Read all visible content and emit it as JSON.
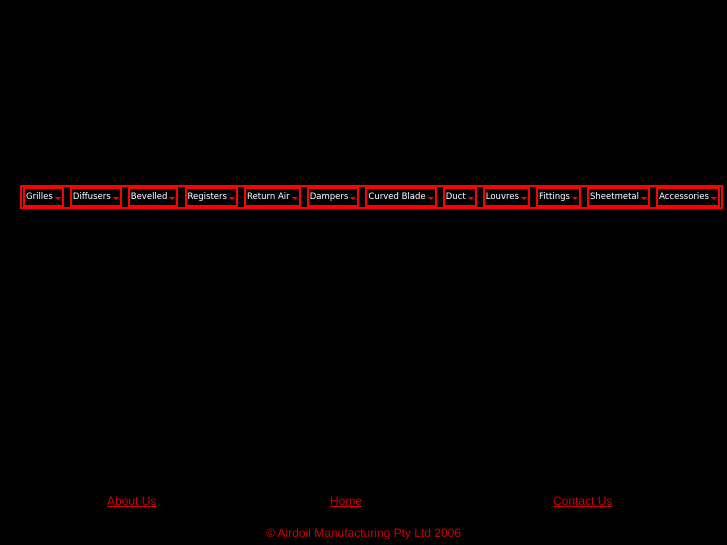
{
  "nav": {
    "items": [
      {
        "label": "Grilles"
      },
      {
        "label": "Diffusers"
      },
      {
        "label": "Bevelled"
      },
      {
        "label": "Registers"
      },
      {
        "label": "Return Air"
      },
      {
        "label": "Dampers"
      },
      {
        "label": "Curved Blade"
      },
      {
        "label": "Duct"
      },
      {
        "label": "Louvres"
      },
      {
        "label": "Fittings"
      },
      {
        "label": "Sheetmetal"
      },
      {
        "label": "Accessories"
      }
    ]
  },
  "footer": {
    "about": "About Us",
    "home": "Home",
    "contact": "Contact Us",
    "copyright": "© Airdoil Manufacturing Pty Ltd 2006"
  },
  "colors": {
    "accent": "#ff0000",
    "link": "#cc0000",
    "background": "#000000"
  }
}
